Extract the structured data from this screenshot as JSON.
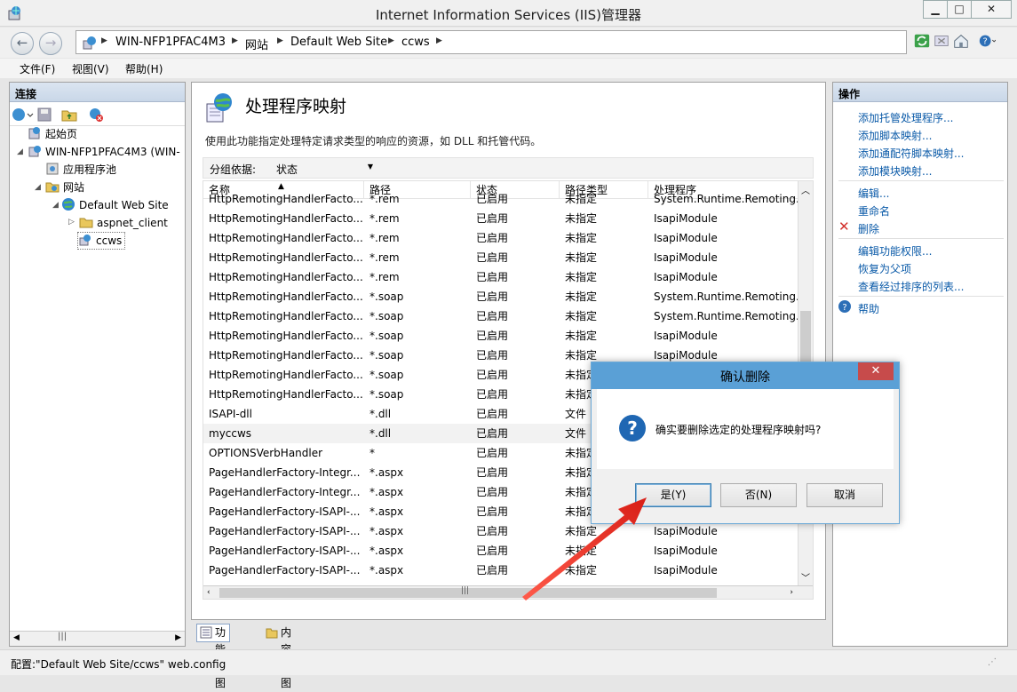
{
  "window": {
    "title": "Internet Information Services (IIS)管理器"
  },
  "address": {
    "crumbs": [
      "WIN-NFP1PFAC4M3",
      "网站",
      "Default Web Site",
      "ccws"
    ]
  },
  "menu": {
    "items": [
      "文件(F)",
      "视图(V)",
      "帮助(H)"
    ]
  },
  "connections": {
    "header": "连接",
    "tree": [
      {
        "label": "起始页"
      },
      {
        "label": "WIN-NFP1PFAC4M3 (WIN-"
      },
      {
        "label": "应用程序池"
      },
      {
        "label": "网站"
      },
      {
        "label": "Default Web Site"
      },
      {
        "label": "aspnet_client"
      },
      {
        "label": "ccws"
      }
    ]
  },
  "center": {
    "title": "处理程序映射",
    "description": "使用此功能指定处理特定请求类型的响应的资源，如 DLL 和托管代码。",
    "group_label": "分组依据:",
    "group_value": "状态",
    "columns": [
      "名称",
      "路径",
      "状态",
      "路径类型",
      "处理程序"
    ],
    "rows": [
      [
        "HttpRemotingHandlerFacto...",
        "*.rem",
        "已启用",
        "未指定",
        "System.Runtime.Remoting...."
      ],
      [
        "HttpRemotingHandlerFacto...",
        "*.rem",
        "已启用",
        "未指定",
        "IsapiModule"
      ],
      [
        "HttpRemotingHandlerFacto...",
        "*.rem",
        "已启用",
        "未指定",
        "IsapiModule"
      ],
      [
        "HttpRemotingHandlerFacto...",
        "*.rem",
        "已启用",
        "未指定",
        "IsapiModule"
      ],
      [
        "HttpRemotingHandlerFacto...",
        "*.rem",
        "已启用",
        "未指定",
        "IsapiModule"
      ],
      [
        "HttpRemotingHandlerFacto...",
        "*.soap",
        "已启用",
        "未指定",
        "System.Runtime.Remoting...."
      ],
      [
        "HttpRemotingHandlerFacto...",
        "*.soap",
        "已启用",
        "未指定",
        "System.Runtime.Remoting...."
      ],
      [
        "HttpRemotingHandlerFacto...",
        "*.soap",
        "已启用",
        "未指定",
        "IsapiModule"
      ],
      [
        "HttpRemotingHandlerFacto...",
        "*.soap",
        "已启用",
        "未指定",
        "IsapiModule"
      ],
      [
        "HttpRemotingHandlerFacto...",
        "*.soap",
        "已启用",
        "未指定",
        ""
      ],
      [
        "HttpRemotingHandlerFacto...",
        "*.soap",
        "已启用",
        "未指定",
        ""
      ],
      [
        "ISAPI-dll",
        "*.dll",
        "已启用",
        "文件",
        ""
      ],
      [
        "myccws",
        "*.dll",
        "已启用",
        "文件",
        ""
      ],
      [
        "OPTIONSVerbHandler",
        "*",
        "已启用",
        "未指定",
        ""
      ],
      [
        "PageHandlerFactory-Integr...",
        "*.aspx",
        "已启用",
        "未指定",
        ""
      ],
      [
        "PageHandlerFactory-Integr...",
        "*.aspx",
        "已启用",
        "未指定",
        ""
      ],
      [
        "PageHandlerFactory-ISAPI-...",
        "*.aspx",
        "已启用",
        "未指定",
        ""
      ],
      [
        "PageHandlerFactory-ISAPI-...",
        "*.aspx",
        "已启用",
        "未指定",
        "IsapiModule"
      ],
      [
        "PageHandlerFactory-ISAPI-...",
        "*.aspx",
        "已启用",
        "未指定",
        "IsapiModule"
      ],
      [
        "PageHandlerFactory-ISAPI-...",
        "*.aspx",
        "已启用",
        "未指定",
        "IsapiModule"
      ]
    ],
    "selected_row": 12
  },
  "view_tabs": [
    "功能视图",
    "内容视图"
  ],
  "actions": {
    "header": "操作",
    "group1": [
      "添加托管处理程序...",
      "添加脚本映射...",
      "添加通配符脚本映射...",
      "添加模块映射..."
    ],
    "group2": [
      "编辑...",
      "重命名",
      "删除"
    ],
    "group3": [
      "编辑功能权限...",
      "恢复为父项",
      "查看经过排序的列表..."
    ],
    "group4": [
      "帮助"
    ]
  },
  "status": {
    "text": "配置:\"Default Web Site/ccws\" web.config"
  },
  "dialog": {
    "title": "确认删除",
    "message": "确实要删除选定的处理程序映射吗?",
    "yes": "是(Y)",
    "no": "否(N)",
    "cancel": "取消"
  },
  "colors": {
    "accent": "#5aa0d6",
    "link": "#0a5aa8",
    "arrow": "#e8312a"
  }
}
